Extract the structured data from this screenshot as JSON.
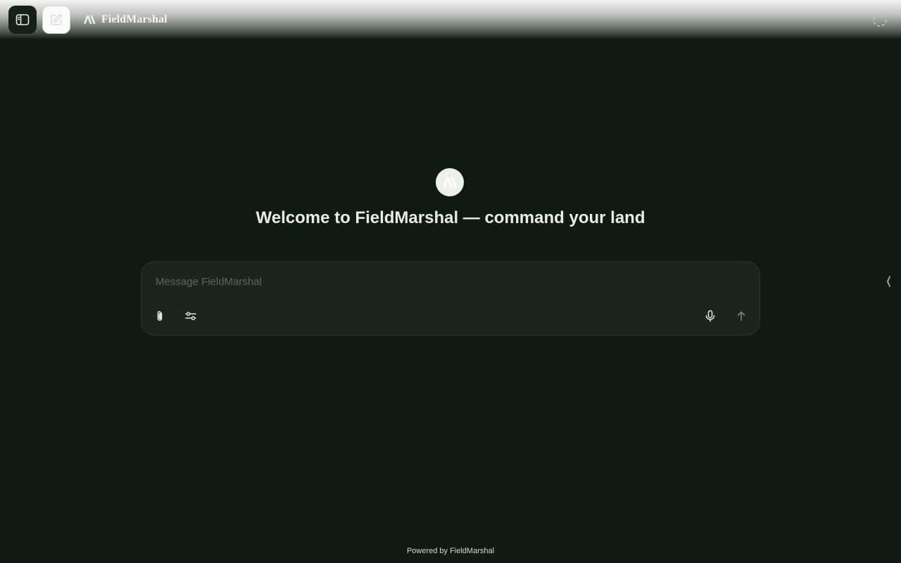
{
  "header": {
    "brand_name": "FieldMarshal",
    "sidebar_toggle_icon": "sidebar-icon",
    "new_chat_icon": "edit-icon",
    "loading_icon": "loading-spinner-icon"
  },
  "main": {
    "avatar_icon": "brand-logo-icon",
    "welcome_title": "Welcome to FieldMarshal — command your land"
  },
  "composer": {
    "placeholder": "Message FieldMarshal",
    "value": "",
    "attach_icon": "paperclip-icon",
    "tools_icon": "sliders-icon",
    "mic_icon": "microphone-icon",
    "send_icon": "arrow-up-icon"
  },
  "footer": {
    "text": "Powered by FieldMarshal"
  },
  "colors": {
    "background": "#111a12",
    "composer_bg": "#1c251d",
    "text_primary": "#e9ebe6",
    "placeholder": "#5d665d"
  }
}
